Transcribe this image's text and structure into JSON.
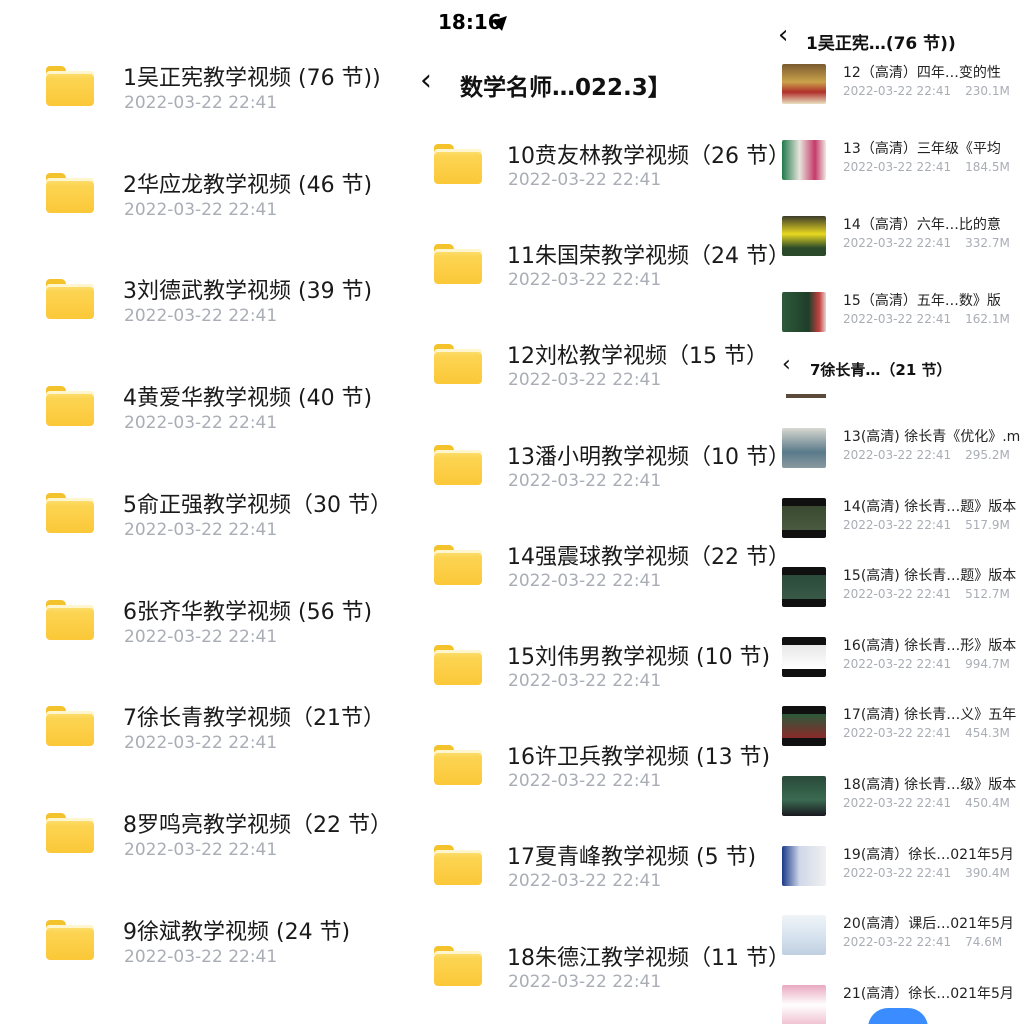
{
  "panel1": {
    "items": [
      {
        "name": "1吴正宪教学视频 (76 节))",
        "date": "2022-03-22 22:41"
      },
      {
        "name": "2华应龙教学视频 (46 节)",
        "date": "2022-03-22 22:41"
      },
      {
        "name": "3刘德武教学视频 (39 节)",
        "date": "2022-03-22 22:41"
      },
      {
        "name": "4黄爱华教学视频 (40 节)",
        "date": "2022-03-22 22:41"
      },
      {
        "name": "5俞正强教学视频（30 节）",
        "date": "2022-03-22 22:41"
      },
      {
        "name": "6张齐华教学视频 (56 节)",
        "date": "2022-03-22 22:41"
      },
      {
        "name": "7徐长青教学视频（21节）",
        "date": "2022-03-22 22:41"
      },
      {
        "name": "8罗鸣亮教学视频（22 节）",
        "date": "2022-03-22 22:41"
      },
      {
        "name": "9徐斌教学视频 (24 节)",
        "date": "2022-03-22 22:41"
      }
    ]
  },
  "panel2": {
    "status_time": "18:16",
    "title": "数学名师…022.3】",
    "items": [
      {
        "name": "10贲友林教学视频（26 节）",
        "date": "2022-03-22 22:41"
      },
      {
        "name": "11朱国荣教学视频（24 节）",
        "date": "2022-03-22 22:41"
      },
      {
        "name": "12刘松教学视频（15 节）",
        "date": "2022-03-22 22:41"
      },
      {
        "name": "13潘小明教学视频（10 节）",
        "date": "2022-03-22 22:41"
      },
      {
        "name": "14强震球教学视频（22 节）",
        "date": "2022-03-22 22:41"
      },
      {
        "name": "15刘伟男教学视频 (10 节)",
        "date": "2022-03-22 22:41"
      },
      {
        "name": "16许卫兵教学视频 (13 节)",
        "date": "2022-03-22 22:41"
      },
      {
        "name": "17夏青峰教学视频 (5 节)",
        "date": "2022-03-22 22:41"
      },
      {
        "name": "18朱德江教学视频（11 节）",
        "date": "2022-03-22 22:41"
      }
    ]
  },
  "panel3": {
    "title_top": "1吴正宪…(76 节))",
    "list_top": [
      {
        "name": "12（高清）四年…变的性",
        "date": "2022-03-22 22:41",
        "size": "230.1M"
      },
      {
        "name": "13（高清）三年级《平均",
        "date": "2022-03-22 22:41",
        "size": "184.5M"
      },
      {
        "name": "14（高清）六年…比的意",
        "date": "2022-03-22 22:41",
        "size": "332.7M"
      },
      {
        "name": "15（高清）五年…数》版",
        "date": "2022-03-22 22:41",
        "size": "162.1M"
      }
    ],
    "title_bottom": "7徐长青…（21 节）",
    "list_bottom": [
      {
        "name": "13(高清) 徐长青《优化》.m",
        "date": "2022-03-22 22:41",
        "size": "295.2M"
      },
      {
        "name": "14(高清) 徐长青…题》版本",
        "date": "2022-03-22 22:41",
        "size": "517.9M"
      },
      {
        "name": "15(高清) 徐长青…题》版本",
        "date": "2022-03-22 22:41",
        "size": "512.7M"
      },
      {
        "name": "16(高清) 徐长青…形》版本",
        "date": "2022-03-22 22:41",
        "size": "994.7M"
      },
      {
        "name": "17(高清) 徐长青…义》五年",
        "date": "2022-03-22 22:41",
        "size": "454.3M"
      },
      {
        "name": "18(高清) 徐长青…级》版本",
        "date": "2022-03-22 22:41",
        "size": "450.4M"
      },
      {
        "name": "19(高清）徐长…021年5月",
        "date": "2022-03-22 22:41",
        "size": "390.4M"
      },
      {
        "name": "20(高清）课后…021年5月",
        "date": "2022-03-22 22:41",
        "size": "74.6M"
      },
      {
        "name": "21(高清）徐长…021年5月",
        "date": "",
        "size": ""
      }
    ]
  },
  "colors": {
    "folder": "#fbc838",
    "date_text": "#a9adb5",
    "accent": "#3b8cff"
  },
  "icons": {
    "folder": "folder-icon",
    "back": "chevron-left-icon",
    "location": "location-arrow-icon"
  }
}
